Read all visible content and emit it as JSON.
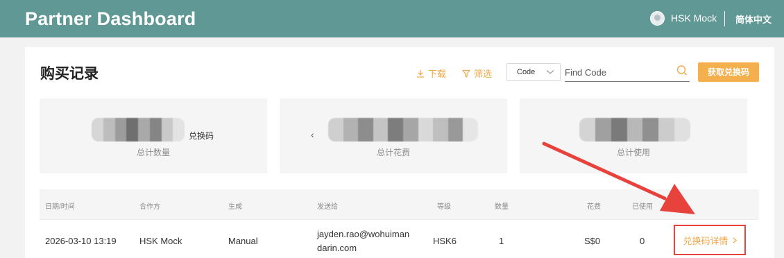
{
  "header": {
    "title": "Partner Dashboard",
    "user_name": "HSK Mock",
    "language": "简体中文",
    "bg_color": "#5f9894"
  },
  "page": {
    "title": "购买记录"
  },
  "toolbar": {
    "download_label": "下载",
    "filter_label": "筛选",
    "code_select_value": "Code",
    "search_placeholder": "Find Code",
    "get_code_button": "获取兑换码",
    "accent_color": "#f0a84a"
  },
  "stats": [
    {
      "label": "总计数量",
      "unit": "兑换码"
    },
    {
      "label": "总计花费",
      "prefix": "‹"
    },
    {
      "label": "总计使用"
    }
  ],
  "table": {
    "headers": [
      "日期/时间",
      "合作方",
      "生成",
      "发送给",
      "等级",
      "数量",
      "花费",
      "已使用"
    ],
    "rows": [
      {
        "datetime": "2026-03-10 13:19",
        "partner": "HSK Mock",
        "generation": "Manual",
        "send_to_line1": "jayden.rao@wohuiman",
        "send_to_line2": "darin.com",
        "level": "HSK6",
        "quantity": "1",
        "cost": "S$0",
        "used": "0",
        "detail_link": "兑换码详情"
      }
    ]
  }
}
